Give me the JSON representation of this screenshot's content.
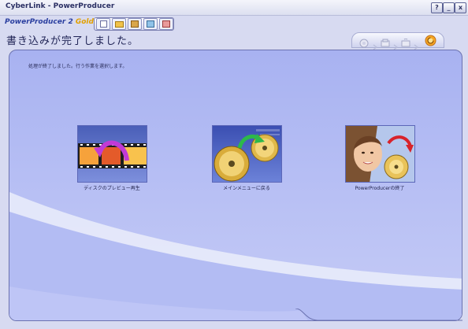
{
  "window": {
    "title": "CyberLink - PowerProducer",
    "buttons": {
      "help": "?",
      "minimize": "_",
      "close": "x"
    }
  },
  "toolbar": {
    "logo_name": "PowerProducer",
    "logo_version": "2",
    "logo_edition": "Gold"
  },
  "heading": "書き込みが完了しました。",
  "instruction": "処理が終了しました。行う作業を選択します。",
  "options": [
    {
      "label": "ディスクのプレビュー再生",
      "icon": "film-reel-arrow-icon"
    },
    {
      "label": "メインメニューに戻る",
      "icon": "disc-arrow-icon"
    },
    {
      "label": "PowerProducerの終了",
      "icon": "woman-disc-icon"
    }
  ],
  "colors": {
    "panel_bg": "#aeb7f2",
    "accent_arrow_green": "#2db84a",
    "accent_arrow_magenta": "#c13ad6",
    "accent_arrow_red": "#d8232a",
    "disc_gold": "#e0b84a"
  }
}
